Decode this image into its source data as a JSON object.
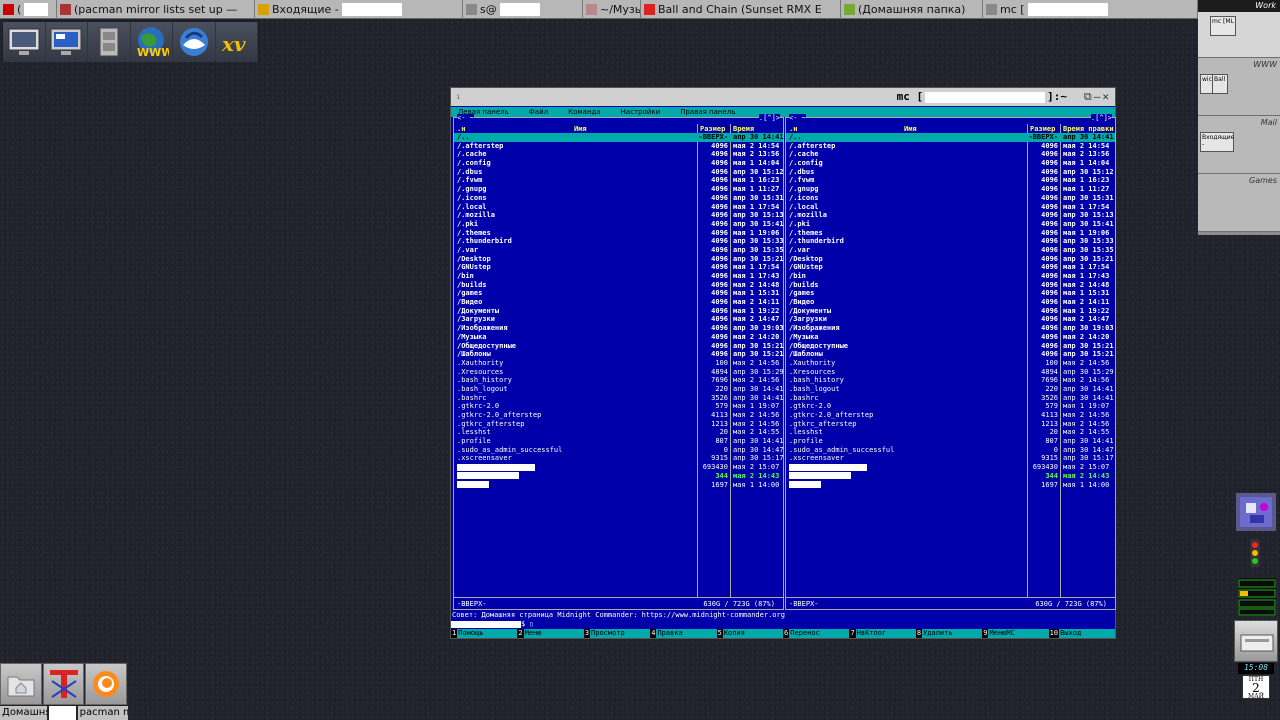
{
  "taskbar": {
    "tasks": [
      {
        "label": "(",
        "width": 57
      },
      {
        "label": "(pacman mirror lists set up —",
        "width": 198
      },
      {
        "label": "Входящие -",
        "width": 208
      },
      {
        "label": "s@",
        "width": 120
      },
      {
        "label": "~/Музыка",
        "width": 58
      },
      {
        "label": "Ball and Chain (Sunset RMX E",
        "width": 200
      },
      {
        "label": "(Домашняя папка)",
        "width": 142
      },
      {
        "label": "mc [",
        "width": 215
      }
    ]
  },
  "pager": {
    "desks": [
      "Work",
      "WWW",
      "Mail",
      "Games"
    ],
    "work_win": "mc [ML",
    "www_win": "wic",
    "www_win2": "Ball",
    "mail_win": "Входящие -"
  },
  "window": {
    "title": "mc [",
    "title_suffix": "]:~",
    "menu": [
      "Левая панель",
      "Файл",
      "Команда",
      "Настройки",
      "Правая панель"
    ],
    "hint": "Совет: Домашняя страница Midnight Commander: https://www.midnight-commander.org",
    "prompt": "$",
    "fkeys": [
      {
        "n": "1",
        "l": "Помощь"
      },
      {
        "n": "2",
        "l": "Меню"
      },
      {
        "n": "3",
        "l": "Просмотр"
      },
      {
        "n": "4",
        "l": "Правка"
      },
      {
        "n": "5",
        "l": "Копия"
      },
      {
        "n": "6",
        "l": "Перенос"
      },
      {
        "n": "7",
        "l": "НвКтлог"
      },
      {
        "n": "8",
        "l": "Удалить"
      },
      {
        "n": "9",
        "l": "МенюМС"
      },
      {
        "n": "10",
        "l": "Выход"
      }
    ]
  },
  "panels": {
    "path": "~",
    "right_mark": ".[^]>",
    "col_n": ".н",
    "col_name": "Имя",
    "col_size": "Размер",
    "col_time": "Время правки",
    "footer": "-ВВЕРХ-",
    "free": "630G / 723G (87%)",
    "rows": [
      {
        "n": "/..",
        "s": "-ВВЕРХ-",
        "t": "апр 30 14:41",
        "k": "sel"
      },
      {
        "n": "/.afterstep",
        "s": "4096",
        "t": "мая 2 14:54",
        "k": "dir"
      },
      {
        "n": "/.cache",
        "s": "4096",
        "t": "мая 2 13:56",
        "k": "dir"
      },
      {
        "n": "/.config",
        "s": "4096",
        "t": "мая 1 14:04",
        "k": "dir"
      },
      {
        "n": "/.dbus",
        "s": "4096",
        "t": "апр 30 15:12",
        "k": "dir"
      },
      {
        "n": "/.fvwm",
        "s": "4096",
        "t": "мая 1 16:23",
        "k": "dir"
      },
      {
        "n": "/.gnupg",
        "s": "4096",
        "t": "мая 1 11:27",
        "k": "dir"
      },
      {
        "n": "/.icons",
        "s": "4096",
        "t": "апр 30 15:31",
        "k": "dir"
      },
      {
        "n": "/.local",
        "s": "4096",
        "t": "мая 1 17:54",
        "k": "dir"
      },
      {
        "n": "/.mozilla",
        "s": "4096",
        "t": "апр 30 15:13",
        "k": "dir"
      },
      {
        "n": "/.pki",
        "s": "4096",
        "t": "апр 30 15:41",
        "k": "dir"
      },
      {
        "n": "/.themes",
        "s": "4096",
        "t": "мая 1 19:06",
        "k": "dir"
      },
      {
        "n": "/.thunderbird",
        "s": "4096",
        "t": "апр 30 15:33",
        "k": "dir"
      },
      {
        "n": "/.var",
        "s": "4096",
        "t": "апр 30 15:35",
        "k": "dir"
      },
      {
        "n": "/Desktop",
        "s": "4096",
        "t": "апр 30 15:21",
        "k": "dir"
      },
      {
        "n": "/GNUstep",
        "s": "4096",
        "t": "мая 1 17:54",
        "k": "dir"
      },
      {
        "n": "/bin",
        "s": "4096",
        "t": "мая 1 17:43",
        "k": "dir"
      },
      {
        "n": "/builds",
        "s": "4096",
        "t": "мая 2 14:48",
        "k": "dir"
      },
      {
        "n": "/games",
        "s": "4096",
        "t": "мая 1 15:31",
        "k": "dir"
      },
      {
        "n": "/Видео",
        "s": "4096",
        "t": "мая 2 14:11",
        "k": "dir"
      },
      {
        "n": "/Документы",
        "s": "4096",
        "t": "мая 1 19:22",
        "k": "dir"
      },
      {
        "n": "/Загрузки",
        "s": "4096",
        "t": "мая 2 14:47",
        "k": "dir"
      },
      {
        "n": "/Изображения",
        "s": "4096",
        "t": "апр 30 19:03",
        "k": "dir"
      },
      {
        "n": "/Музыка",
        "s": "4096",
        "t": "мая 2 14:20",
        "k": "dir"
      },
      {
        "n": "/Общедоступные",
        "s": "4096",
        "t": "апр 30 15:21",
        "k": "dir"
      },
      {
        "n": "/Шаблоны",
        "s": "4096",
        "t": "апр 30 15:21",
        "k": "dir"
      },
      {
        "n": " .Xauthority",
        "s": "100",
        "t": "мая 2 14:56",
        "k": "file"
      },
      {
        "n": " .Xresources",
        "s": "4894",
        "t": "апр 30 15:29",
        "k": "file"
      },
      {
        "n": " .bash_history",
        "s": "7696",
        "t": "мая 2 14:56",
        "k": "file"
      },
      {
        "n": " .bash_logout",
        "s": "220",
        "t": "апр 30 14:41",
        "k": "file"
      },
      {
        "n": " .bashrc",
        "s": "3526",
        "t": "апр 30 14:41",
        "k": "file"
      },
      {
        "n": " .gtkrc-2.0",
        "s": "579",
        "t": "мая 1 19:07",
        "k": "file"
      },
      {
        "n": " .gtkrc-2.0_afterstep",
        "s": "4113",
        "t": "мая 2 14:56",
        "k": "file"
      },
      {
        "n": " .gtkrc_afterstep",
        "s": "1213",
        "t": "мая 2 14:56",
        "k": "file"
      },
      {
        "n": " .lesshst",
        "s": "20",
        "t": "мая 2 14:55",
        "k": "file"
      },
      {
        "n": " .profile",
        "s": "807",
        "t": "апр 30 14:41",
        "k": "file"
      },
      {
        "n": " .sudo_as_admin_successful",
        "s": "0",
        "t": "апр 30 14:47",
        "k": "file"
      },
      {
        "n": " .xscreensaver",
        "s": "9315",
        "t": "апр 30 15:17",
        "k": "file"
      },
      {
        "n": "",
        "s": "693430",
        "t": "мая 2 15:07",
        "k": "file",
        "r": 78
      },
      {
        "n": "",
        "s": "344",
        "t": "мая 2 14:43",
        "k": "exec",
        "r": 62
      },
      {
        "n": "",
        "s": "1697",
        "t": "мая 1 14:00",
        "k": "file",
        "r": 32
      }
    ]
  },
  "dock": {
    "labels": [
      "Домашня",
      "",
      "pacman m"
    ]
  },
  "clock": {
    "time": "15:08",
    "weekday": "ПТН",
    "day": "2",
    "month": "МАЙ"
  }
}
